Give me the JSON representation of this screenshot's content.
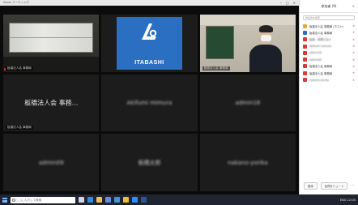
{
  "window": {
    "title": "Zoom ミーティング"
  },
  "tiles": [
    {
      "kind": "video-classroom",
      "label": "板橋法人会 事務局"
    },
    {
      "kind": "logo",
      "logo_text": "ITABASHI",
      "label": "ITABASHI"
    },
    {
      "kind": "video-person",
      "label": "板橋法人会 事務局"
    },
    {
      "kind": "name",
      "name": "板橋法人会 事務...",
      "label": "板橋法人会 事務局",
      "blurred": false
    },
    {
      "kind": "name",
      "name": "Akifumi mimura",
      "label": "",
      "blurred": true
    },
    {
      "kind": "name",
      "name": "admin18",
      "label": "",
      "blurred": true
    },
    {
      "kind": "name",
      "name": "admin09",
      "label": "",
      "blurred": true
    },
    {
      "kind": "name",
      "name": "板橋太郎",
      "label": "",
      "blurred": true
    },
    {
      "kind": "name",
      "name": "nakano-yorika",
      "label": "",
      "blurred": true
    }
  ],
  "participants_panel": {
    "header": "参加者 (9)",
    "search_placeholder": "参加者を検索",
    "rows": [
      {
        "name": "板橋法人会 事務局 (ホスト)",
        "color": "#e5a935",
        "blurred": false
      },
      {
        "name": "板橋法人会 事務局",
        "color": "#2b6fc2",
        "blurred": false
      },
      {
        "name": "板橋・税理士法人",
        "color": "#d83a3a",
        "blurred": true
      },
      {
        "name": "Akifumi mimura",
        "color": "#d83a3a",
        "blurred": true
      },
      {
        "name": "admin18",
        "color": "#d83a3a",
        "blurred": true
      },
      {
        "name": "admin09",
        "color": "#d83a3a",
        "blurred": true
      },
      {
        "name": "板橋法人会 事務局",
        "color": "#d83a3a",
        "blurred": false
      },
      {
        "name": "板橋法人会 事務局",
        "color": "#d83a3a",
        "blurred": false
      },
      {
        "name": "nakano-yorika",
        "color": "#d83a3a",
        "blurred": true
      }
    ],
    "footer": {
      "invite": "招待",
      "mute_all": "全員をミュート",
      "more": "..."
    }
  },
  "taskbar": {
    "search_placeholder": "ここに入力して検索",
    "apps": [
      {
        "icon": "task-view-icon",
        "color": "#cfd6e6"
      },
      {
        "icon": "edge-icon",
        "color": "#2c8ee0"
      },
      {
        "icon": "folder-icon",
        "color": "#f2c14e"
      },
      {
        "icon": "store-icon",
        "color": "#6b8bd6"
      },
      {
        "icon": "mail-icon",
        "color": "#4a90d9"
      },
      {
        "icon": "chrome-icon",
        "color": "#e8c03a"
      },
      {
        "icon": "zoom-icon",
        "color": "#2d8cff"
      },
      {
        "icon": "word-icon",
        "color": "#2b5797"
      }
    ],
    "tray_text": "ENG  12:00"
  }
}
